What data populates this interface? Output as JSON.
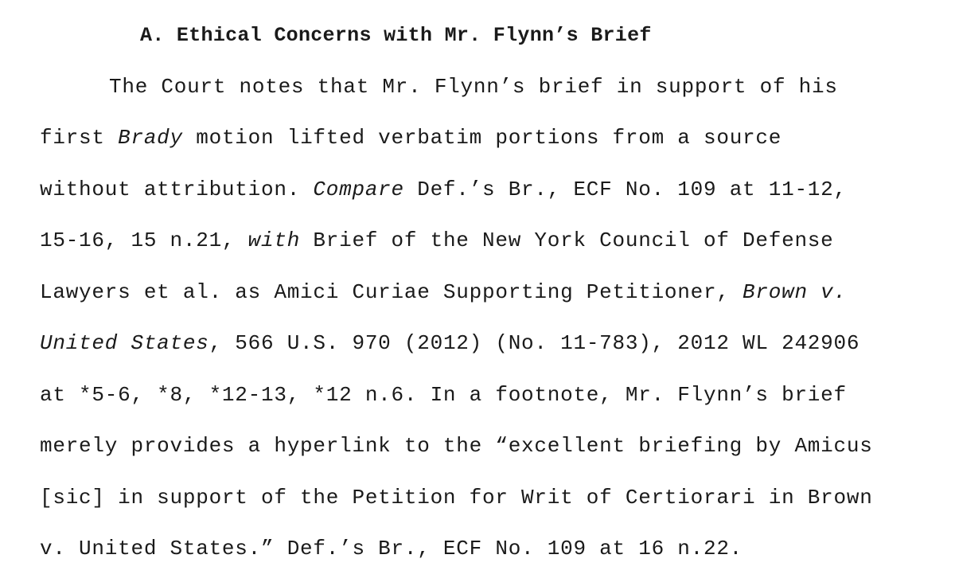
{
  "section": {
    "heading_label": "A.",
    "heading_title": "Ethical Concerns with Mr. Flynn’s Brief"
  },
  "paragraph": {
    "line1": "The Court notes that Mr. Flynn’s brief in support of his",
    "line2_a": "first ",
    "line2_i": "Brady",
    "line2_b": " motion lifted verbatim portions from a source",
    "line3_a": "without attribution. ",
    "line3_i": "Compare",
    "line3_b": " Def.’s Br., ECF No. 109 at 11-12,",
    "line4_a": "15-16, 15 n.21, ",
    "line4_i": "with",
    "line4_b": " Brief of the New York Council of Defense",
    "line5_a": "Lawyers et al. as Amici Curiae Supporting Petitioner, ",
    "line5_i": "Brown v.",
    "line6_i": "United States",
    "line6_b": ", 566 U.S. 970 (2012) (No. 11-783), 2012 WL 242906",
    "line7": "at *5-6, *8, *12-13, *12 n.6. In a footnote, Mr. Flynn’s brief",
    "line8": "merely provides a hyperlink to the “excellent briefing by Amicus",
    "line9": "[sic] in support of the Petition for Writ of Certiorari in Brown",
    "line10": "v. United States.” Def.’s Br., ECF No. 109 at 16 n.22."
  }
}
